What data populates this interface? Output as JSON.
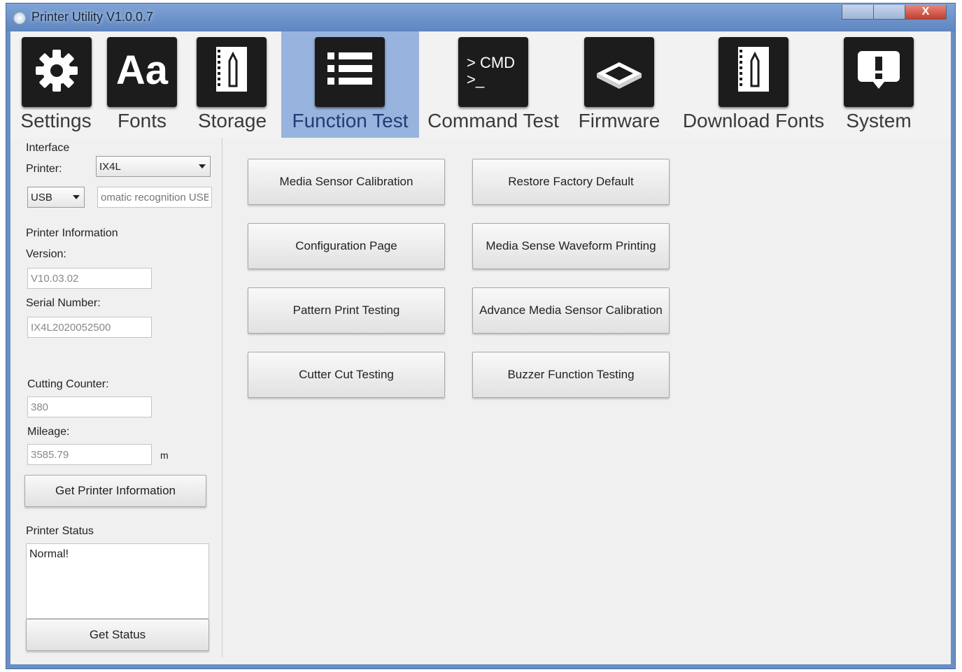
{
  "window": {
    "title": "Printer Utility  V1.0.0.7",
    "close_glyph": "X"
  },
  "toolbar": {
    "items": [
      {
        "label": "Settings",
        "icon": "gear-icon"
      },
      {
        "label": "Fonts",
        "icon": "font-aa-icon",
        "icon_text": "Aa"
      },
      {
        "label": "Storage",
        "icon": "storage-icon"
      },
      {
        "label": "Function Test",
        "icon": "list-icon",
        "active": true
      },
      {
        "label": "Command Test",
        "icon": "cmd-icon",
        "icon_text_1": "> CMD",
        "icon_text_2": ">_"
      },
      {
        "label": "Firmware",
        "icon": "chip-icon"
      },
      {
        "label": "Download Fonts",
        "icon": "download-fonts-icon"
      },
      {
        "label": "System",
        "icon": "alert-icon"
      }
    ]
  },
  "left": {
    "interface_label": "Interface",
    "printer_label": "Printer:",
    "printer_value": "IX4L",
    "port_value": "USB",
    "auto_recognition_placeholder": "omatic recognition USB",
    "printer_info_label": "Printer Information",
    "version_label": "Version:",
    "version_value": "V10.03.02",
    "serial_label": "Serial Number:",
    "serial_value": "IX4L2020052500",
    "cutting_label": "Cutting Counter:",
    "cutting_value": "380",
    "mileage_label": "Mileage:",
    "mileage_value": "3585.79",
    "mileage_unit": "m",
    "get_info_button": "Get Printer Information",
    "status_label": "Printer Status",
    "status_value": "Normal!",
    "get_status_button": "Get Status"
  },
  "main": {
    "buttons": [
      "Media Sensor Calibration",
      "Restore Factory Default",
      "Configuration Page",
      "Media Sense Waveform Printing",
      "Pattern Print Testing",
      "Advance Media Sensor Calibration",
      "Cutter Cut Testing",
      "Buzzer Function Testing"
    ]
  },
  "colors": {
    "title_bar": "#6a8fc4",
    "active_tab": "#98b4de",
    "icon_tile": "#1c1c1c",
    "panel_bg": "#f0f0f0"
  }
}
